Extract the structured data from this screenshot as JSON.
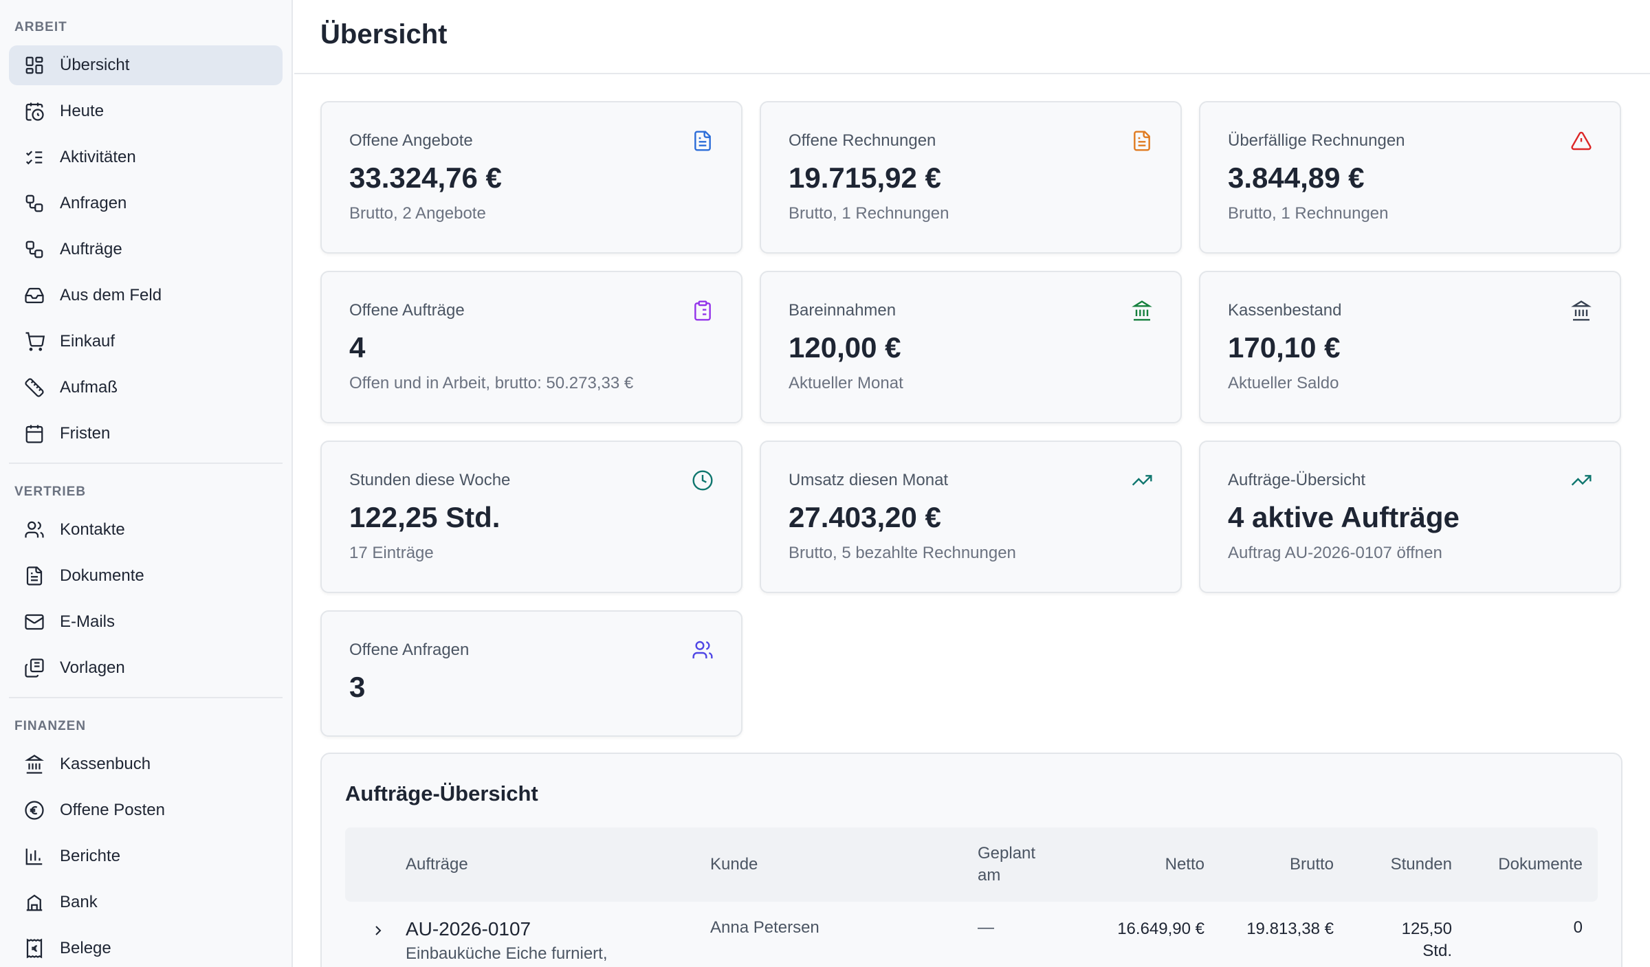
{
  "sidebar": {
    "sections": [
      {
        "heading": "ARBEIT",
        "items": [
          {
            "label": "Übersicht",
            "icon": "dashboard-icon"
          },
          {
            "label": "Heute",
            "icon": "calendar-clock-icon"
          },
          {
            "label": "Aktivitäten",
            "icon": "list-checks-icon"
          },
          {
            "label": "Anfragen",
            "icon": "workflow-icon"
          },
          {
            "label": "Aufträge",
            "icon": "workflow-icon"
          },
          {
            "label": "Aus dem Feld",
            "icon": "inbox-icon"
          },
          {
            "label": "Einkauf",
            "icon": "cart-icon"
          },
          {
            "label": "Aufmaß",
            "icon": "ruler-icon"
          },
          {
            "label": "Fristen",
            "icon": "calendar-icon"
          }
        ]
      },
      {
        "heading": "VERTRIEB",
        "items": [
          {
            "label": "Kontakte",
            "icon": "users-icon"
          },
          {
            "label": "Dokumente",
            "icon": "document-icon"
          },
          {
            "label": "E-Mails",
            "icon": "mail-icon"
          },
          {
            "label": "Vorlagen",
            "icon": "copy-icon"
          }
        ]
      },
      {
        "heading": "FINANZEN",
        "items": [
          {
            "label": "Kassenbuch",
            "icon": "bank-icon"
          },
          {
            "label": "Offene Posten",
            "icon": "euro-circle-icon"
          },
          {
            "label": "Berichte",
            "icon": "bar-chart-icon"
          },
          {
            "label": "Bank",
            "icon": "building-icon"
          },
          {
            "label": "Belege",
            "icon": "euro-receipt-icon"
          }
        ]
      }
    ]
  },
  "header": {
    "title": "Übersicht"
  },
  "cards": [
    {
      "title": "Offene Angebote",
      "value": "33.324,76 €",
      "sub": "Brutto, 2 Angebote",
      "icon": "document-icon",
      "color": "#2b6cd8"
    },
    {
      "title": "Offene Rechnungen",
      "value": "19.715,92 €",
      "sub": "Brutto, 1 Rechnungen",
      "icon": "document-icon",
      "color": "#e07a1f"
    },
    {
      "title": "Überfällige Rechnungen",
      "value": "3.844,89 €",
      "sub": "Brutto, 1 Rechnungen",
      "icon": "alert-triangle-icon",
      "color": "#dc2626"
    },
    {
      "title": "Offene Aufträge",
      "value": "4",
      "sub": "Offen und in Arbeit, brutto: 50.273,33 €",
      "icon": "clipboard-icon",
      "color": "#9333ea"
    },
    {
      "title": "Bareinnahmen",
      "value": "120,00 €",
      "sub": "Aktueller Monat",
      "icon": "bank-icon",
      "color": "#15803d"
    },
    {
      "title": "Kassenbestand",
      "value": "170,10 €",
      "sub": "Aktueller Saldo",
      "icon": "bank-icon",
      "color": "#374151"
    },
    {
      "title": "Stunden diese Woche",
      "value": "122,25 Std.",
      "sub": "17 Einträge",
      "icon": "clock-icon",
      "color": "#0f766e"
    },
    {
      "title": "Umsatz diesen Monat",
      "value": "27.403,20 €",
      "sub": "Brutto, 5 bezahlte Rechnungen",
      "icon": "trending-up-icon",
      "color": "#0f766e"
    },
    {
      "title": "Aufträge-Übersicht",
      "value": "4 aktive Aufträge",
      "sub": "Auftrag AU-2026-0107 öffnen",
      "icon": "trending-up-icon",
      "color": "#0f766e"
    },
    {
      "title": "Offene Anfragen",
      "value": "3",
      "sub": "",
      "icon": "users-icon",
      "color": "#4f46e5"
    }
  ],
  "orders_panel": {
    "title": "Aufträge-Übersicht",
    "columns": {
      "order": "Aufträge",
      "customer": "Kunde",
      "planned": "Geplant am",
      "net": "Netto",
      "gross": "Brutto",
      "hours": "Stunden",
      "documents": "Dokumente"
    },
    "rows": [
      {
        "id": "AU-2026-0107",
        "description": "Einbauküche Eiche furniert,",
        "customer": "Anna Petersen",
        "planned": "—",
        "net": "16.649,90 €",
        "gross": "19.813,38 €",
        "hours": "125,50 Std.",
        "documents": "0"
      }
    ]
  }
}
